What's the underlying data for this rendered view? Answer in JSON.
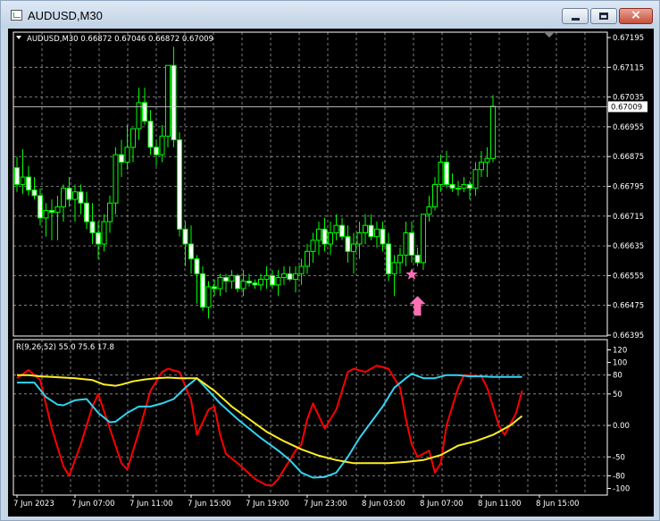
{
  "window": {
    "title": "AUDUSD,M30",
    "minimize": "minimize",
    "maximize": "maximize",
    "close": "close"
  },
  "colors": {
    "background": "#000000",
    "grid": "#9a9a9a",
    "foreground": "#ffffff",
    "candle_up": "#000000",
    "candle_down": "#ffffff",
    "wick": "#00ff00",
    "pink": "#ff6fb4",
    "red": "#ff0000",
    "cyan": "#33d4f2",
    "yellow": "#ffee22"
  },
  "main": {
    "info": "AUDUSD,M30  0.66872 0.67046 0.66872 0.67009",
    "price_ticks": [
      "0.67195",
      "0.67115",
      "0.67035",
      "0.66955",
      "0.66875",
      "0.66795",
      "0.66715",
      "0.66635",
      "0.66555",
      "0.66475",
      "0.66395"
    ],
    "price_tick_values": [
      0.67195,
      0.67115,
      0.67035,
      0.66955,
      0.66875,
      0.66795,
      0.66715,
      0.66635,
      0.66555,
      0.66475,
      0.66395
    ],
    "current_price": "0.67009",
    "current_price_value": 0.67009,
    "markers": [
      {
        "type": "star",
        "time_index": 68,
        "price": 0.66558,
        "color": "#ff6fb4"
      },
      {
        "type": "arrow-up",
        "time_index": 69,
        "price": 0.665,
        "color": "#ff6fb4"
      }
    ]
  },
  "indicator": {
    "label": "R(9,26,52) 55.0 75.6 17.8",
    "ticks": [
      "120",
      "100",
      "80",
      "50",
      "0.00",
      "-50",
      "-80",
      "-100"
    ],
    "tick_values": [
      120,
      100,
      80,
      50,
      0,
      -50,
      -80,
      -100
    ],
    "series": [
      {
        "color": "#ff0000",
        "points": [
          [
            0,
            75
          ],
          [
            2,
            88
          ],
          [
            4,
            72
          ],
          [
            6,
            -5
          ],
          [
            8,
            -65
          ],
          [
            9,
            -80
          ],
          [
            11,
            -30
          ],
          [
            13,
            30
          ],
          [
            14,
            50
          ],
          [
            16,
            -5
          ],
          [
            18,
            -60
          ],
          [
            19,
            -70
          ],
          [
            21,
            -10
          ],
          [
            23,
            55
          ],
          [
            25,
            85
          ],
          [
            26,
            90
          ],
          [
            28,
            85
          ],
          [
            30,
            40
          ],
          [
            31,
            -15
          ],
          [
            33,
            25
          ],
          [
            34,
            30
          ],
          [
            35,
            -15
          ],
          [
            36,
            -45
          ],
          [
            38,
            -60
          ],
          [
            41,
            -85
          ],
          [
            43,
            -95
          ],
          [
            44,
            -95
          ],
          [
            45,
            -85
          ],
          [
            47,
            -55
          ],
          [
            48,
            -40
          ],
          [
            49,
            -30
          ],
          [
            50,
            10
          ],
          [
            51,
            35
          ],
          [
            53,
            -5
          ],
          [
            55,
            25
          ],
          [
            56,
            55
          ],
          [
            57,
            85
          ],
          [
            58,
            90
          ],
          [
            60,
            85
          ],
          [
            61,
            90
          ],
          [
            62,
            95
          ],
          [
            64,
            90
          ],
          [
            66,
            60
          ],
          [
            67,
            10
          ],
          [
            68,
            -30
          ],
          [
            69,
            -50
          ],
          [
            71,
            -40
          ],
          [
            72,
            -75
          ],
          [
            73,
            -60
          ],
          [
            74,
            0
          ],
          [
            76,
            60
          ],
          [
            77,
            80
          ],
          [
            80,
            78
          ],
          [
            81,
            60
          ],
          [
            82,
            30
          ],
          [
            83,
            0
          ],
          [
            84,
            -15
          ],
          [
            86,
            20
          ],
          [
            87,
            55
          ]
        ]
      },
      {
        "color": "#33d4f2",
        "points": [
          [
            0,
            68
          ],
          [
            3,
            68
          ],
          [
            5,
            45
          ],
          [
            7,
            33
          ],
          [
            8,
            32
          ],
          [
            10,
            40
          ],
          [
            12,
            42
          ],
          [
            14,
            20
          ],
          [
            16,
            5
          ],
          [
            17,
            6
          ],
          [
            19,
            20
          ],
          [
            21,
            30
          ],
          [
            23,
            30
          ],
          [
            25,
            35
          ],
          [
            27,
            42
          ],
          [
            29,
            60
          ],
          [
            31,
            75
          ],
          [
            33,
            55
          ],
          [
            35,
            35
          ],
          [
            38,
            10
          ],
          [
            42,
            -20
          ],
          [
            45,
            -40
          ],
          [
            47,
            -55
          ],
          [
            49,
            -75
          ],
          [
            51,
            -83
          ],
          [
            53,
            -82
          ],
          [
            55,
            -75
          ],
          [
            57,
            -50
          ],
          [
            59,
            -20
          ],
          [
            61,
            5
          ],
          [
            63,
            30
          ],
          [
            65,
            60
          ],
          [
            67,
            75
          ],
          [
            68,
            82
          ],
          [
            70,
            75
          ],
          [
            72,
            75
          ],
          [
            74,
            80
          ],
          [
            76,
            80
          ],
          [
            78,
            78
          ],
          [
            80,
            78
          ],
          [
            82,
            77
          ],
          [
            84,
            77
          ],
          [
            87,
            77
          ]
        ]
      },
      {
        "color": "#ffee22",
        "points": [
          [
            0,
            80
          ],
          [
            2,
            80
          ],
          [
            4,
            78
          ],
          [
            6,
            77
          ],
          [
            8,
            76
          ],
          [
            10,
            75
          ],
          [
            12,
            73
          ],
          [
            13,
            72
          ],
          [
            15,
            65
          ],
          [
            17,
            63
          ],
          [
            18,
            65
          ],
          [
            20,
            70
          ],
          [
            22,
            73
          ],
          [
            24,
            75
          ],
          [
            26,
            76
          ],
          [
            28,
            75
          ],
          [
            31,
            75
          ],
          [
            34,
            55
          ],
          [
            37,
            30
          ],
          [
            40,
            10
          ],
          [
            43,
            -10
          ],
          [
            46,
            -25
          ],
          [
            49,
            -38
          ],
          [
            52,
            -48
          ],
          [
            55,
            -55
          ],
          [
            58,
            -60
          ],
          [
            61,
            -60
          ],
          [
            64,
            -60
          ],
          [
            67,
            -58
          ],
          [
            70,
            -55
          ],
          [
            73,
            -47
          ],
          [
            76,
            -32
          ],
          [
            79,
            -25
          ],
          [
            82,
            -15
          ],
          [
            85,
            0
          ],
          [
            87,
            15
          ]
        ]
      }
    ]
  },
  "x_axis": {
    "labels": [
      "7 Jun 2023",
      "7 Jun 07:00",
      "7 Jun 11:00",
      "7 Jun 15:00",
      "7 Jun 19:00",
      "7 Jun 23:00",
      "8 Jun 03:00",
      "8 Jun 07:00",
      "8 Jun 11:00",
      "8 Jun 15:00"
    ],
    "label_indices": [
      0,
      10,
      20,
      30,
      40,
      50,
      60,
      70,
      80,
      90
    ]
  },
  "candles": [
    [
      0.66845,
      0.66875,
      0.6678,
      0.668
    ],
    [
      0.668,
      0.66895,
      0.66775,
      0.6682
    ],
    [
      0.6682,
      0.6685,
      0.6677,
      0.66785
    ],
    [
      0.66785,
      0.6682,
      0.6676,
      0.6677
    ],
    [
      0.6677,
      0.6679,
      0.6669,
      0.6671
    ],
    [
      0.6671,
      0.6675,
      0.6666,
      0.6673
    ],
    [
      0.6673,
      0.6676,
      0.6665,
      0.66725
    ],
    [
      0.66725,
      0.6677,
      0.6665,
      0.6674
    ],
    [
      0.6674,
      0.668,
      0.667,
      0.6679
    ],
    [
      0.6679,
      0.6682,
      0.6674,
      0.6676
    ],
    [
      0.6676,
      0.668,
      0.667,
      0.6678
    ],
    [
      0.6678,
      0.668,
      0.6672,
      0.6675
    ],
    [
      0.6675,
      0.6678,
      0.6668,
      0.667
    ],
    [
      0.667,
      0.6675,
      0.6664,
      0.6667
    ],
    [
      0.6667,
      0.667,
      0.666,
      0.6664
    ],
    [
      0.6664,
      0.6672,
      0.6662,
      0.667
    ],
    [
      0.667,
      0.6677,
      0.6667,
      0.6675
    ],
    [
      0.6675,
      0.669,
      0.6672,
      0.6688
    ],
    [
      0.6688,
      0.6692,
      0.6682,
      0.6686
    ],
    [
      0.6686,
      0.6696,
      0.6684,
      0.669
    ],
    [
      0.669,
      0.6695,
      0.6686,
      0.6695
    ],
    [
      0.6695,
      0.6706,
      0.6692,
      0.6702
    ],
    [
      0.6702,
      0.6706,
      0.6696,
      0.6697
    ],
    [
      0.6697,
      0.67,
      0.6688,
      0.669
    ],
    [
      0.669,
      0.6692,
      0.6685,
      0.6688
    ],
    [
      0.6688,
      0.6696,
      0.6686,
      0.6693
    ],
    [
      0.6693,
      0.6711,
      0.669,
      0.6712
    ],
    [
      0.6712,
      0.6717,
      0.669,
      0.6692
    ],
    [
      0.6692,
      0.6694,
      0.6666,
      0.6668
    ],
    [
      0.6668,
      0.667,
      0.6658,
      0.6664
    ],
    [
      0.6664,
      0.6669,
      0.6656,
      0.666
    ],
    [
      0.666,
      0.6661,
      0.6648,
      0.6656
    ],
    [
      0.6656,
      0.6658,
      0.6646,
      0.6647
    ],
    [
      0.6647,
      0.6654,
      0.6644,
      0.66525
    ],
    [
      0.66525,
      0.66545,
      0.665,
      0.6652
    ],
    [
      0.6652,
      0.6656,
      0.665,
      0.6655
    ],
    [
      0.6655,
      0.6656,
      0.6651,
      0.6654
    ],
    [
      0.6654,
      0.6657,
      0.6652,
      0.66555
    ],
    [
      0.66555,
      0.6656,
      0.6651,
      0.6652
    ],
    [
      0.6652,
      0.6657,
      0.665,
      0.6654
    ],
    [
      0.6654,
      0.6656,
      0.66525,
      0.66535
    ],
    [
      0.66535,
      0.66545,
      0.6652,
      0.6653
    ],
    [
      0.6653,
      0.6656,
      0.66515,
      0.66545
    ],
    [
      0.66545,
      0.6658,
      0.6652,
      0.66555
    ],
    [
      0.66555,
      0.6657,
      0.6652,
      0.6653
    ],
    [
      0.6653,
      0.6657,
      0.665,
      0.6655
    ],
    [
      0.6655,
      0.6658,
      0.6653,
      0.6656
    ],
    [
      0.6656,
      0.6658,
      0.6654,
      0.66545
    ],
    [
      0.66545,
      0.6658,
      0.6651,
      0.6656
    ],
    [
      0.6656,
      0.666,
      0.6653,
      0.6658
    ],
    [
      0.6658,
      0.6664,
      0.6656,
      0.6662
    ],
    [
      0.6662,
      0.6667,
      0.6659,
      0.6665
    ],
    [
      0.6665,
      0.667,
      0.6661,
      0.6668
    ],
    [
      0.6668,
      0.6671,
      0.6662,
      0.6664
    ],
    [
      0.6664,
      0.667,
      0.6661,
      0.6667
    ],
    [
      0.6667,
      0.6672,
      0.6665,
      0.6669
    ],
    [
      0.6669,
      0.6671,
      0.6665,
      0.6666
    ],
    [
      0.6666,
      0.6669,
      0.6659,
      0.6662
    ],
    [
      0.6662,
      0.6667,
      0.6656,
      0.6664
    ],
    [
      0.6664,
      0.667,
      0.666,
      0.6667
    ],
    [
      0.6667,
      0.6672,
      0.6664,
      0.6669
    ],
    [
      0.6669,
      0.6672,
      0.6665,
      0.6666
    ],
    [
      0.6666,
      0.667,
      0.6663,
      0.6668
    ],
    [
      0.6668,
      0.667,
      0.6662,
      0.6664
    ],
    [
      0.6664,
      0.6667,
      0.6654,
      0.6656
    ],
    [
      0.6656,
      0.6661,
      0.665,
      0.6659
    ],
    [
      0.6659,
      0.6663,
      0.6656,
      0.6661
    ],
    [
      0.6661,
      0.667,
      0.6658,
      0.6667
    ],
    [
      0.6667,
      0.667,
      0.6659,
      0.6661
    ],
    [
      0.6661,
      0.6663,
      0.6658,
      0.6659
    ],
    [
      0.6659,
      0.6672,
      0.6657,
      0.6672
    ],
    [
      0.6672,
      0.6677,
      0.667,
      0.6674
    ],
    [
      0.6674,
      0.6682,
      0.6673,
      0.668
    ],
    [
      0.668,
      0.6688,
      0.6678,
      0.6686
    ],
    [
      0.6686,
      0.6689,
      0.6679,
      0.668
    ],
    [
      0.668,
      0.6683,
      0.6678,
      0.6679
    ],
    [
      0.6679,
      0.6681,
      0.6677,
      0.6679
    ],
    [
      0.6679,
      0.6682,
      0.6678,
      0.668
    ],
    [
      0.668,
      0.6681,
      0.6676,
      0.6679
    ],
    [
      0.6679,
      0.6686,
      0.6677,
      0.6684
    ],
    [
      0.6684,
      0.6689,
      0.6682,
      0.6686
    ],
    [
      0.6686,
      0.669,
      0.6682,
      0.6687
    ],
    [
      0.6687,
      0.6704,
      0.6686,
      0.6701
    ]
  ]
}
